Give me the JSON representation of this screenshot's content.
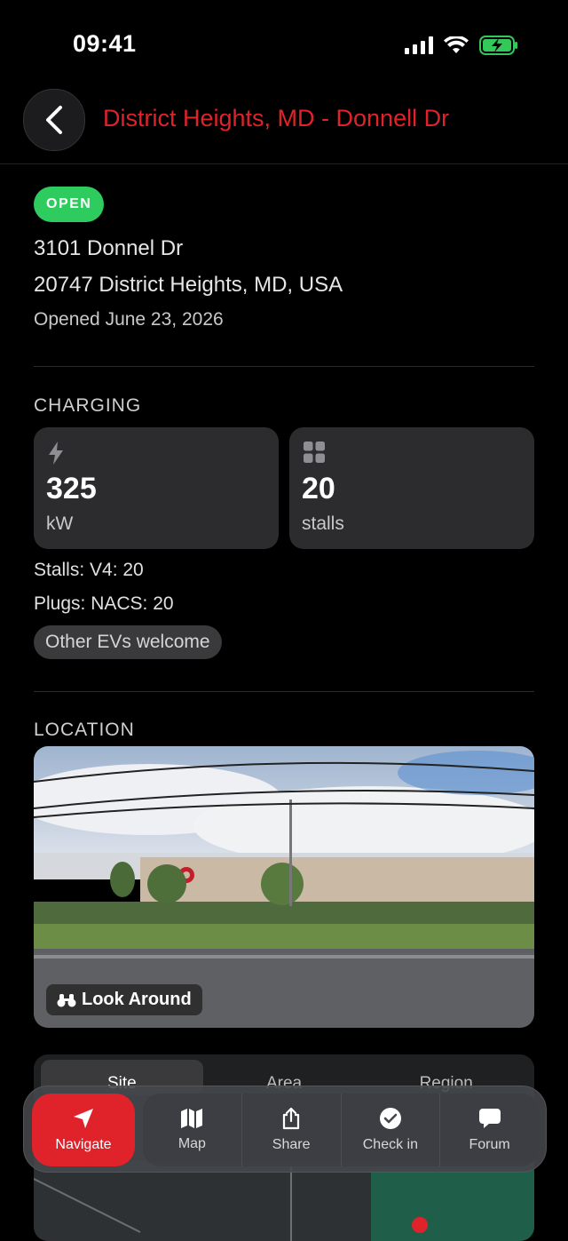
{
  "status": {
    "time": "09:41"
  },
  "header": {
    "title": "District Heights, MD - Donnell Dr"
  },
  "station": {
    "badge": "OPEN",
    "street": "3101 Donnel Dr",
    "city": "20747 District Heights, MD, USA",
    "opened": "Opened June 23, 2026"
  },
  "charging": {
    "section_title": "CHARGING",
    "power_value": "325",
    "power_unit": "kW",
    "stalls_value": "20",
    "stalls_unit": "stalls",
    "stalls_line": "Stalls: V4: 20",
    "plugs_line": "Plugs: NACS: 20",
    "chip": "Other EVs welcome"
  },
  "location": {
    "section_title": "LOCATION",
    "look_around": "Look Around",
    "map_tabs": [
      "Site",
      "Area",
      "Region"
    ]
  },
  "toolbar": {
    "navigate": "Navigate",
    "map": "Map",
    "share": "Share",
    "checkin": "Check in",
    "forum": "Forum"
  },
  "colors": {
    "accent": "#e0222b",
    "open": "#2ecc5e",
    "card": "#2c2c2e"
  }
}
